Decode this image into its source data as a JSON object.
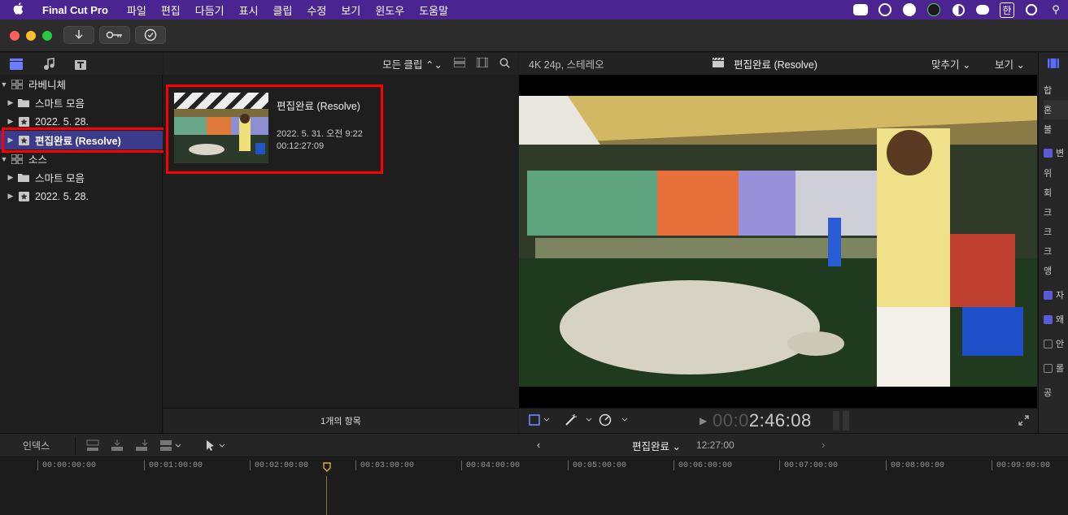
{
  "menubar": {
    "app": "Final Cut Pro",
    "items": [
      "파일",
      "편집",
      "다듬기",
      "표시",
      "클립",
      "수정",
      "보기",
      "윈도우",
      "도움말"
    ],
    "tray": [
      "zoom-icon",
      "wordpress-icon",
      "teamviewer-icon",
      "dollar-icon",
      "contrast-icon",
      "chat-icon",
      "한",
      "play-circle-icon",
      "share-icon"
    ]
  },
  "browser": {
    "filter_label": "모든 클립",
    "footer": "1개의 항목",
    "clip": {
      "title": "편집완료 (Resolve)",
      "date": "2022. 5. 31. 오전 9:22",
      "duration": "00:12:27:09"
    }
  },
  "sidebar": {
    "items": [
      {
        "label": "라베니체",
        "level": 0,
        "expanded": true
      },
      {
        "label": "스마트 모음",
        "level": 1
      },
      {
        "label": "2022. 5. 28.",
        "level": 1
      },
      {
        "label": "편집완료 (Resolve)",
        "level": 1,
        "selected": true
      },
      {
        "label": "소스",
        "level": 0,
        "expanded": true
      },
      {
        "label": "스마트 모음",
        "level": 1
      },
      {
        "label": "2022. 5. 28.",
        "level": 1
      }
    ]
  },
  "viewer": {
    "format": "4K 24p, 스테레오",
    "title": "편집완료 (Resolve)",
    "fit_label": "맞추기",
    "view_label": "보기",
    "timecode_dim": "00:0",
    "timecode": "2:46:08"
  },
  "inspector": {
    "rows": [
      {
        "label": "합",
        "check": null
      },
      {
        "label": "혼",
        "check": null
      },
      {
        "label": "불",
        "check": null
      },
      {
        "label": "변",
        "check": true
      },
      {
        "label": "위",
        "check": null
      },
      {
        "label": "회",
        "check": null
      },
      {
        "label": "크",
        "check": null
      },
      {
        "label": "크",
        "check": null
      },
      {
        "label": "크",
        "check": null
      },
      {
        "label": "앵",
        "check": null
      },
      {
        "label": "자",
        "check": true
      },
      {
        "label": "왜",
        "check": true
      },
      {
        "label": "안",
        "check": false
      },
      {
        "label": "롤",
        "check": false
      },
      {
        "label": "공",
        "check": null
      }
    ]
  },
  "timeline": {
    "index_label": "인덱스",
    "project_label": "편집완료",
    "project_duration": "12:27:00",
    "ticks": [
      "00:00:00:00",
      "00:01:00:00",
      "00:02:00:00",
      "00:03:00:00",
      "00:04:00:00",
      "00:05:00:00",
      "00:06:00:00",
      "00:07:00:00",
      "00:08:00:00",
      "00:09:00:00"
    ]
  },
  "colors": {
    "menubar": "#4a2592",
    "selection": "#3b3b8c",
    "highlight": "#ff0000",
    "checkbox": "#5b5bd6"
  }
}
